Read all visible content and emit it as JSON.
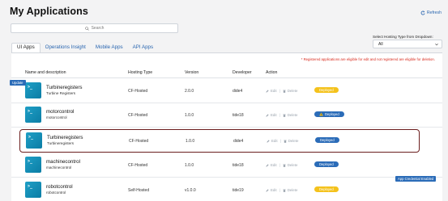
{
  "page": {
    "title": "My Applications"
  },
  "refresh": {
    "label": "Refresh"
  },
  "search": {
    "placeholder": "Search"
  },
  "hosting_filter": {
    "label": "Select Hosting Type from Dropdown:",
    "value": "All"
  },
  "tabs": [
    {
      "label": "UI Apps",
      "active": true
    },
    {
      "label": "Operations Insight",
      "active": false
    },
    {
      "label": "Mobile Apps",
      "active": false
    },
    {
      "label": "API Apps",
      "active": false
    }
  ],
  "note": "* Registered applications are eligible for edit and not registered are eligible for deletion.",
  "table": {
    "columns": [
      "Name and description",
      "Hosting Type",
      "Version",
      "Developer",
      "Action"
    ],
    "action_labels": {
      "edit": "Edit",
      "delete": "Delete"
    },
    "rows": [
      {
        "name": "Turbineregisters",
        "description": "Turbine Registers",
        "hosting": "CF-Hosted",
        "version": "2.0.0",
        "developer": "dide4",
        "status": "Deployed",
        "status_style": "yellow",
        "warning": false
      },
      {
        "name": "motorcontrol",
        "description": "motorcontrol",
        "hosting": "CF-Hosted",
        "version": "1.0.0",
        "developer": "tide18",
        "status": "Deployed",
        "status_style": "deployed",
        "warning": true
      },
      {
        "name": "Turbineregisters",
        "description": "Turbineregisters",
        "hosting": "CF-Hosted",
        "version": "1.0.0",
        "developer": "dide4",
        "status": "Deployed",
        "status_style": "deployed",
        "warning": false
      },
      {
        "name": "machinecontrol",
        "description": "machinecontrol",
        "hosting": "CF-Hosted",
        "version": "1.0.0",
        "developer": "tide18",
        "status": "Deployed",
        "status_style": "deployed",
        "warning": false
      },
      {
        "name": "robotcontrol",
        "description": "robotcontrol",
        "hosting": "Self-Hosted",
        "version": "v1.0.0",
        "developer": "tide19",
        "status": "Deployed",
        "status_style": "yellow",
        "warning": false
      }
    ]
  },
  "tags": {
    "update": "Update",
    "credential": "App Credential Enabled"
  },
  "icons": {
    "app": "terminal-icon",
    "refresh": "refresh-icon",
    "search": "search-icon",
    "edit": "pencil-icon",
    "delete": "trash-icon",
    "warning": "warning-icon",
    "dropdown": "chevron-down-icon"
  },
  "colors": {
    "accent": "#2b6cb8",
    "warning_badge": "#f4c21c",
    "selected_outline": "#6b1e1e",
    "note": "#d9291c"
  }
}
